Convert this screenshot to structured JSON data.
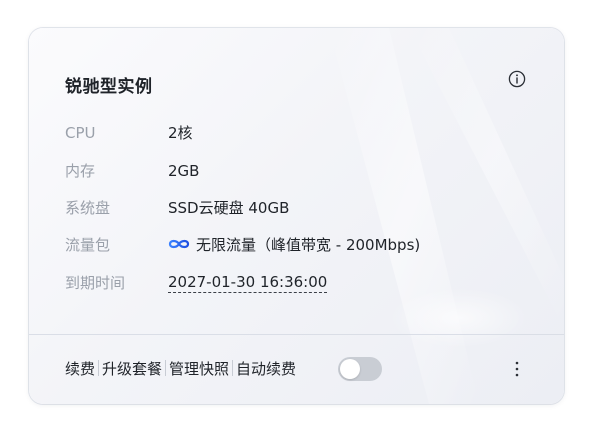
{
  "card": {
    "title": "锐驰型实例",
    "info_icon": "info-circle-icon",
    "specs": [
      {
        "label": "CPU",
        "value": "2核"
      },
      {
        "label": "内存",
        "value": "2GB"
      },
      {
        "label": "系统盘",
        "value": "SSD云硬盘 40GB"
      },
      {
        "label": "流量包",
        "value": "无限流量（峰值带宽 - 200Mbps)",
        "icon": "infinity-icon"
      },
      {
        "label": "到期时间",
        "value": "2027-01-30 16:36:00"
      }
    ],
    "actions": [
      "续费",
      "升级套餐",
      "管理快照",
      "自动续费"
    ],
    "auto_renew_enabled": false,
    "more_icon": "more-vertical-icon"
  },
  "colors": {
    "text_primary": "#1f2329",
    "text_secondary": "#9aa0aa",
    "infinity_accent": "#1f5bff",
    "toggle_off": "#c9cdd4"
  }
}
